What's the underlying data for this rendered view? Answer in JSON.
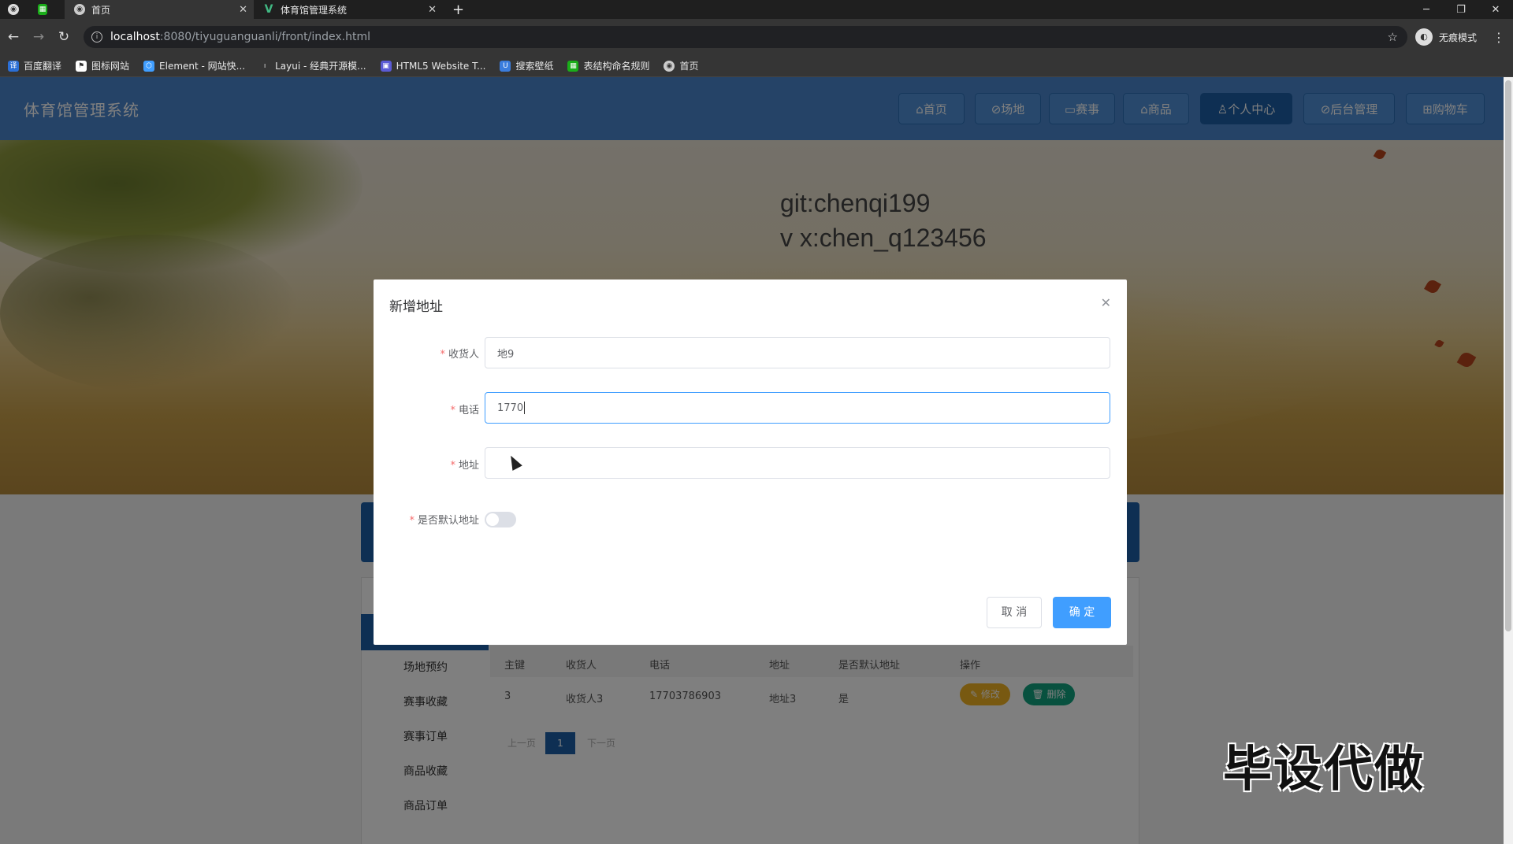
{
  "browser": {
    "tabs": [
      {
        "title": "首页",
        "active": true
      },
      {
        "title": "体育馆管理系统",
        "active": false
      }
    ],
    "new_tab_icon": "plus-icon",
    "url_host": "localhost",
    "url_path": ":8080/tiyuguanguanli/front/index.html",
    "profile_label": "无痕模式",
    "bookmarks": [
      "百度翻译",
      "图标网站",
      "Element - 网站快...",
      "Layui - 经典开源模...",
      "HTML5 Website T...",
      "搜索壁纸",
      "表结构命名规则",
      "首页"
    ]
  },
  "site": {
    "title": "体育馆管理系统",
    "nav": [
      {
        "label": "⌂首页",
        "icon": "home-icon"
      },
      {
        "label": "⊘场地",
        "icon": "venue-icon"
      },
      {
        "label": "▭赛事",
        "icon": "event-icon"
      },
      {
        "label": "⌂商品",
        "icon": "goods-icon"
      },
      {
        "label": "♙个人中心",
        "icon": "user-icon",
        "active": true
      },
      {
        "label": "⊘后台管理",
        "icon": "link-icon"
      },
      {
        "label": "⊞购物车",
        "icon": "cart-icon"
      }
    ],
    "colors": {
      "header": "#4a86cf",
      "active_nav": "#1d5fa6",
      "primary": "#409eff"
    }
  },
  "banner": {
    "line1": "git:chenqi199",
    "line2": "v x:chen_q123456"
  },
  "sidebar": {
    "items": [
      "场地预约",
      "赛事收藏",
      "赛事订单",
      "商品收藏",
      "商品订单"
    ]
  },
  "table": {
    "headers": [
      "主键",
      "收货人",
      "电话",
      "地址",
      "是否默认地址",
      "操作"
    ],
    "rows": [
      {
        "id": "3",
        "name": "收货人3",
        "phone": "17703786903",
        "address": "地址3",
        "default": "是"
      }
    ],
    "edit_label": "✎ 修改",
    "delete_label": "🗑 删除"
  },
  "pagination": {
    "prev": "上一页",
    "current": "1",
    "next": "下一页"
  },
  "watermark": "毕设代做",
  "dialog": {
    "title": "新增地址",
    "fields": {
      "consignee": {
        "label": "收货人",
        "value": "地9"
      },
      "phone": {
        "label": "电话",
        "value": "1770"
      },
      "address": {
        "label": "地址",
        "value": ""
      },
      "is_default": {
        "label": "是否默认地址",
        "value": false
      }
    },
    "cancel_label": "取 消",
    "confirm_label": "确 定"
  }
}
